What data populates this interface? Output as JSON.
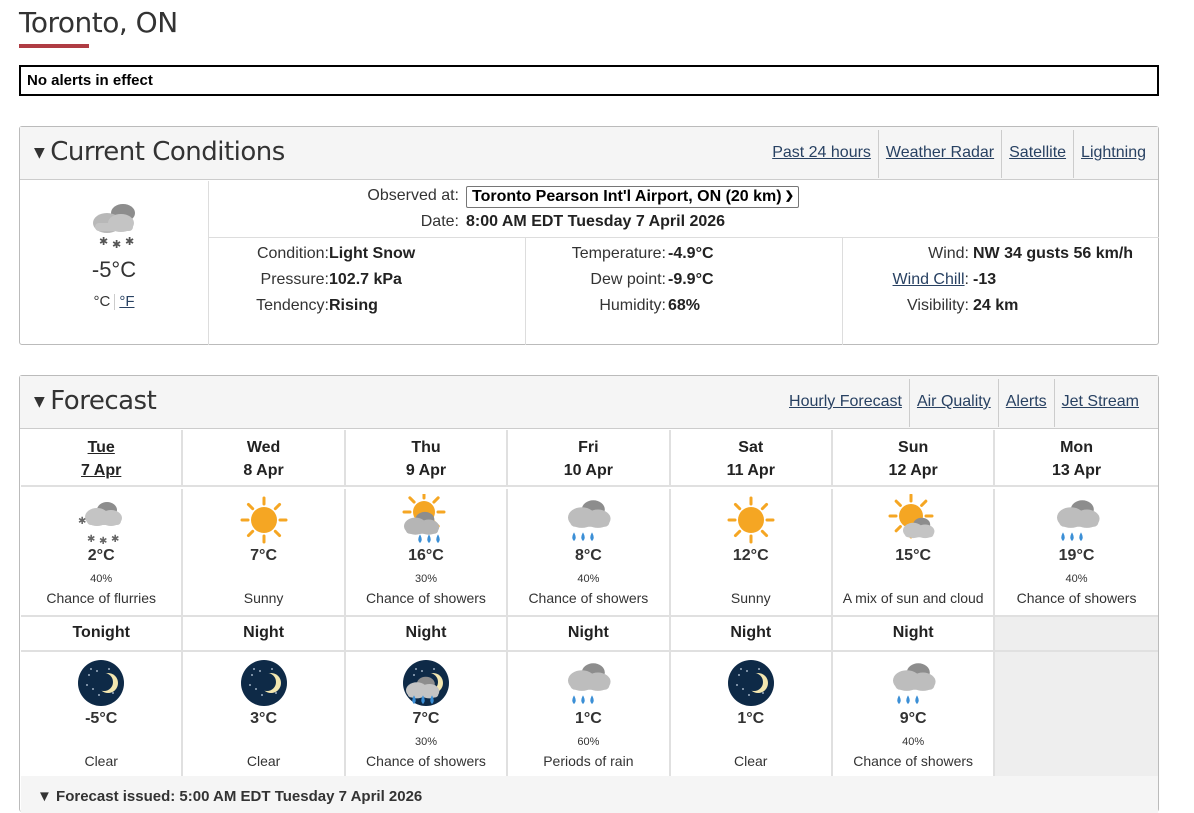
{
  "location": {
    "title": "Toronto, ON"
  },
  "alert": {
    "text": "No alerts in effect"
  },
  "colors": {
    "accent": "#af3c43",
    "link": "#284162",
    "sun": "#f5a623",
    "cloud": "#9e9e9e",
    "rain": "#3b8fd6",
    "night": "#0e2a47"
  },
  "current": {
    "heading": "Current Conditions",
    "caret": "▼",
    "links": [
      "Past 24 hours",
      "Weather Radar",
      "Satellite",
      "Lightning"
    ],
    "icon": "cloud-snow-icon",
    "temp": "-5°C",
    "unit_c": "°C",
    "unit_f": "°F",
    "observed_label": "Observed at:",
    "observed_station": "Toronto Pearson Int'l Airport, ON (20 km)",
    "date_label": "Date:",
    "date_value": "8:00 AM EDT Tuesday 7 April 2026",
    "condition_label": "Condition:",
    "condition": "Light Snow",
    "pressure_label": "Pressure:",
    "pressure": "102.7 kPa",
    "tendency_label": "Tendency:",
    "tendency": "Rising",
    "temperature_label": "Temperature:",
    "temperature": "-4.9°C",
    "dewpoint_label": "Dew point:",
    "dewpoint": "-9.9°C",
    "humidity_label": "Humidity:",
    "humidity": "68%",
    "wind_label": "Wind:",
    "wind": "NW 34 gusts 56 km/h",
    "windchill_label": "Wind Chill",
    "windchill": "-13",
    "visibility_label": "Visibility:",
    "visibility": "24 km"
  },
  "forecast": {
    "heading": "Forecast",
    "caret": "▼",
    "links": [
      "Hourly Forecast",
      "Air Quality",
      "Alerts",
      "Jet Stream"
    ],
    "days": [
      {
        "day": "Tue",
        "date": "7 Apr",
        "icon": "snow-flurries-icon",
        "temp": "2°C",
        "pop": "40%",
        "summary": "Chance of flurries"
      },
      {
        "day": "Wed",
        "date": "8 Apr",
        "icon": "sun-icon",
        "temp": "7°C",
        "pop": "",
        "summary": "Sunny"
      },
      {
        "day": "Thu",
        "date": "9 Apr",
        "icon": "sun-showers-icon",
        "temp": "16°C",
        "pop": "30%",
        "summary": "Chance of showers"
      },
      {
        "day": "Fri",
        "date": "10 Apr",
        "icon": "showers-icon",
        "temp": "8°C",
        "pop": "40%",
        "summary": "Chance of showers"
      },
      {
        "day": "Sat",
        "date": "11 Apr",
        "icon": "sun-icon",
        "temp": "12°C",
        "pop": "",
        "summary": "Sunny"
      },
      {
        "day": "Sun",
        "date": "12 Apr",
        "icon": "sun-cloud-icon",
        "temp": "15°C",
        "pop": "",
        "summary": "A mix of sun and cloud"
      },
      {
        "day": "Mon",
        "date": "13 Apr",
        "icon": "showers-icon",
        "temp": "19°C",
        "pop": "40%",
        "summary": "Chance of showers"
      }
    ],
    "nights": [
      {
        "label": "Tonight",
        "icon": "moon-clear-icon",
        "temp": "-5°C",
        "pop": "",
        "summary": "Clear"
      },
      {
        "label": "Night",
        "icon": "moon-clear-icon",
        "temp": "3°C",
        "pop": "",
        "summary": "Clear"
      },
      {
        "label": "Night",
        "icon": "moon-showers-icon",
        "temp": "7°C",
        "pop": "30%",
        "summary": "Chance of showers"
      },
      {
        "label": "Night",
        "icon": "rain-icon",
        "temp": "1°C",
        "pop": "60%",
        "summary": "Periods of rain"
      },
      {
        "label": "Night",
        "icon": "moon-clear-icon",
        "temp": "1°C",
        "pop": "",
        "summary": "Clear"
      },
      {
        "label": "Night",
        "icon": "showers-icon",
        "temp": "9°C",
        "pop": "40%",
        "summary": "Chance of showers"
      }
    ],
    "issued": "Forecast issued: 5:00 AM EDT Tuesday 7 April 2026"
  }
}
